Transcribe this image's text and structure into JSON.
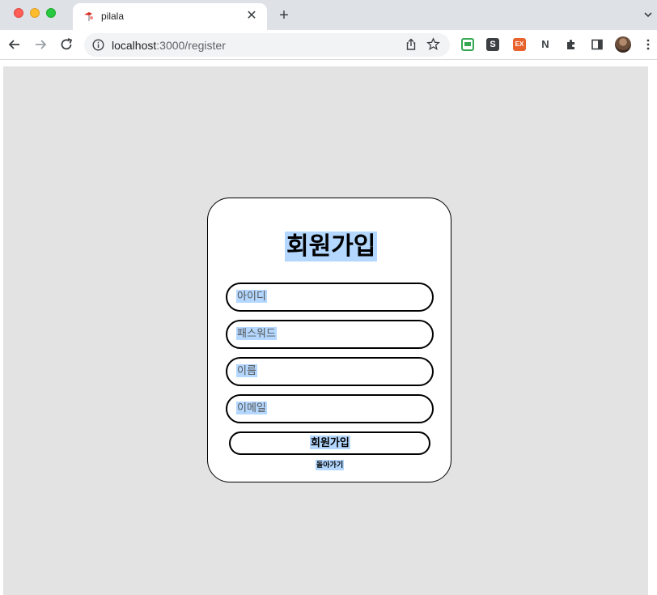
{
  "browser": {
    "tab_title": "pilala",
    "tab_close": "✕",
    "new_tab": "+",
    "url_host": "localhost",
    "url_path": ":3000/register",
    "extensions": {
      "s_label": "S",
      "ex_label": "EX",
      "n_label": "N"
    }
  },
  "register": {
    "title": "회원가입",
    "fields": [
      {
        "placeholder": "아이디"
      },
      {
        "placeholder": "패스워드"
      },
      {
        "placeholder": "이름"
      },
      {
        "placeholder": "이메일"
      }
    ],
    "submit_label": "회원가입",
    "back_label": "돌아가기"
  },
  "colors": {
    "page_background": "#e3e3e3",
    "selection_highlight": "#b3d7fe",
    "card_border": "#000000"
  }
}
